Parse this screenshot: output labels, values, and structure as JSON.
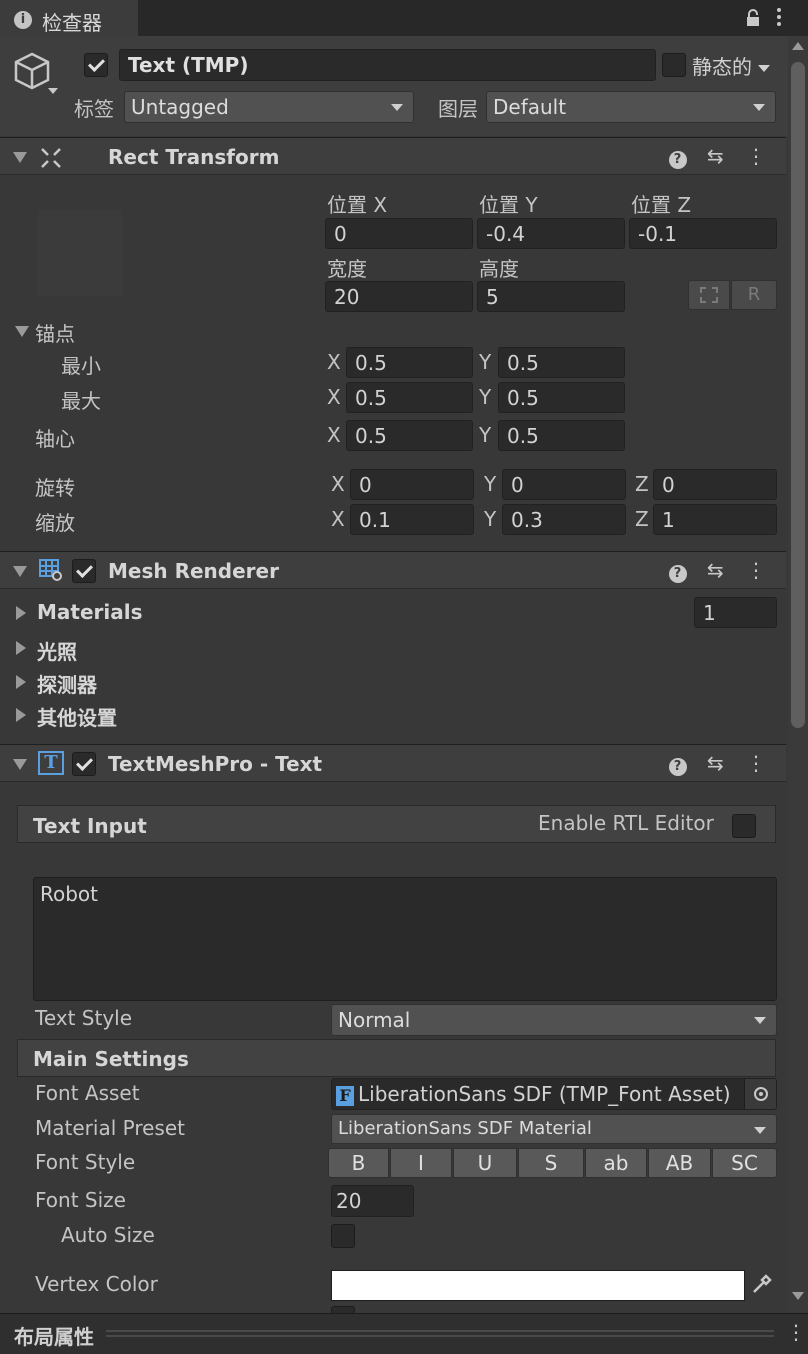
{
  "tab": {
    "icon": "info-icon",
    "label": "检查器"
  },
  "object": {
    "name": "Text (TMP)",
    "static_label": "静态的",
    "tag_label": "标签",
    "tag_value": "Untagged",
    "layer_label": "图层",
    "layer_value": "Default"
  },
  "rect_transform": {
    "title": "Rect Transform",
    "pos_x_label": "位置 X",
    "pos_y_label": "位置 Y",
    "pos_z_label": "位置 Z",
    "pos_x": "0",
    "pos_y": "-0.4",
    "pos_z": "-0.1",
    "width_label": "宽度",
    "height_label": "高度",
    "width": "20",
    "height": "5",
    "r_button": "R",
    "anchors_label": "锚点",
    "min_label": "最小",
    "max_label": "最大",
    "anchor_min_x": "0.5",
    "anchor_min_y": "0.5",
    "anchor_max_x": "0.5",
    "anchor_max_y": "0.5",
    "pivot_label": "轴心",
    "pivot_x": "0.5",
    "pivot_y": "0.5",
    "rotation_label": "旋转",
    "rot_x": "0",
    "rot_y": "0",
    "rot_z": "0",
    "scale_label": "缩放",
    "scale_x": "0.1",
    "scale_y": "0.3",
    "scale_z": "1",
    "axis_x": "X",
    "axis_y": "Y",
    "axis_z": "Z"
  },
  "mesh_renderer": {
    "title": "Mesh Renderer",
    "materials_label": "Materials",
    "materials_count": "1",
    "lighting_label": "光照",
    "probes_label": "探测器",
    "other_label": "其他设置"
  },
  "tmp": {
    "title": "TextMeshPro - Text",
    "text_input_label": "Text Input",
    "rtl_label": "Enable RTL Editor",
    "text_value": "Robot",
    "text_style_label": "Text Style",
    "text_style_value": "Normal",
    "main_settings_label": "Main Settings",
    "font_asset_label": "Font Asset",
    "font_asset_value": "LiberationSans SDF (TMP_Font Asset)",
    "material_preset_label": "Material Preset",
    "material_preset_value": "LiberationSans SDF Material",
    "font_style_label": "Font Style",
    "font_styles": [
      "B",
      "I",
      "U",
      "S",
      "ab",
      "AB",
      "SC"
    ],
    "font_size_label": "Font Size",
    "font_size_value": "20",
    "auto_size_label": "Auto Size",
    "vertex_color_label": "Vertex Color",
    "vertex_color": "#ffffff"
  },
  "footer": {
    "label": "布局属性"
  }
}
